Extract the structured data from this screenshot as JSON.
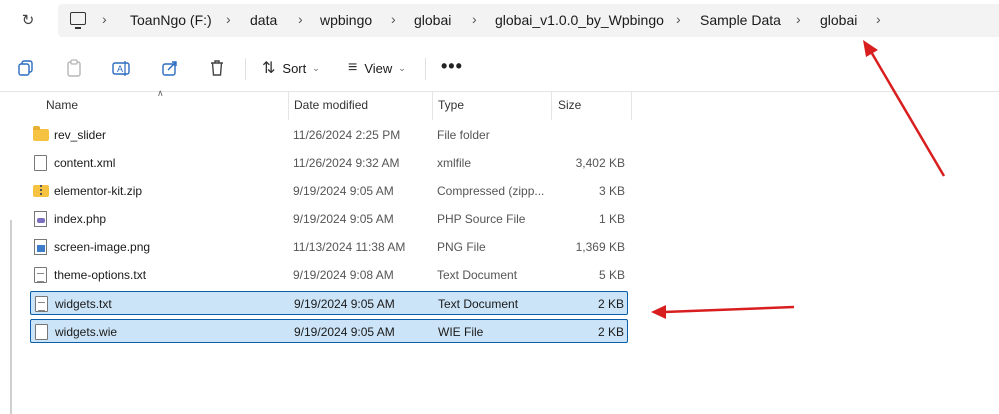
{
  "address_bar": {
    "crumbs": [
      "ToanNgo (F:)",
      "data",
      "wpbingo",
      "globai",
      "globai_v1.0.0_by_Wpbingo",
      "Sample Data",
      "globai"
    ]
  },
  "toolbar": {
    "sort_label": "Sort",
    "view_label": "View",
    "more_label": "•••"
  },
  "columns": {
    "name": "Name",
    "date": "Date modified",
    "type": "Type",
    "size": "Size"
  },
  "files": [
    {
      "name": "rev_slider",
      "date": "11/26/2024 2:25 PM",
      "type": "File folder",
      "size": "",
      "icon": "folder-icon"
    },
    {
      "name": "content.xml",
      "date": "11/26/2024 9:32 AM",
      "type": "xmlfile",
      "size": "3,402 KB",
      "icon": "file-icon"
    },
    {
      "name": "elementor-kit.zip",
      "date": "9/19/2024 9:05 AM",
      "type": "Compressed (zipp...",
      "size": "3 KB",
      "icon": "zip-folder-icon"
    },
    {
      "name": "index.php",
      "date": "9/19/2024 9:05 AM",
      "type": "PHP Source File",
      "size": "1 KB",
      "icon": "php-file-icon"
    },
    {
      "name": "screen-image.png",
      "date": "11/13/2024 11:38 AM",
      "type": "PNG File",
      "size": "1,369 KB",
      "icon": "image-file-icon"
    },
    {
      "name": "theme-options.txt",
      "date": "9/19/2024 9:08 AM",
      "type": "Text Document",
      "size": "5 KB",
      "icon": "text-file-icon"
    },
    {
      "name": "widgets.txt",
      "date": "9/19/2024 9:05 AM",
      "type": "Text Document",
      "size": "2 KB",
      "icon": "text-file-icon",
      "selected": true
    },
    {
      "name": "widgets.wie",
      "date": "9/19/2024 9:05 AM",
      "type": "WIE File",
      "size": "2 KB",
      "icon": "file-icon",
      "selected": true
    }
  ],
  "colors": {
    "selection_bg": "#cce4f7",
    "selection_border": "#0a5ea8",
    "annotation_arrow": "#d81e1e",
    "folder": "#f5c341"
  }
}
